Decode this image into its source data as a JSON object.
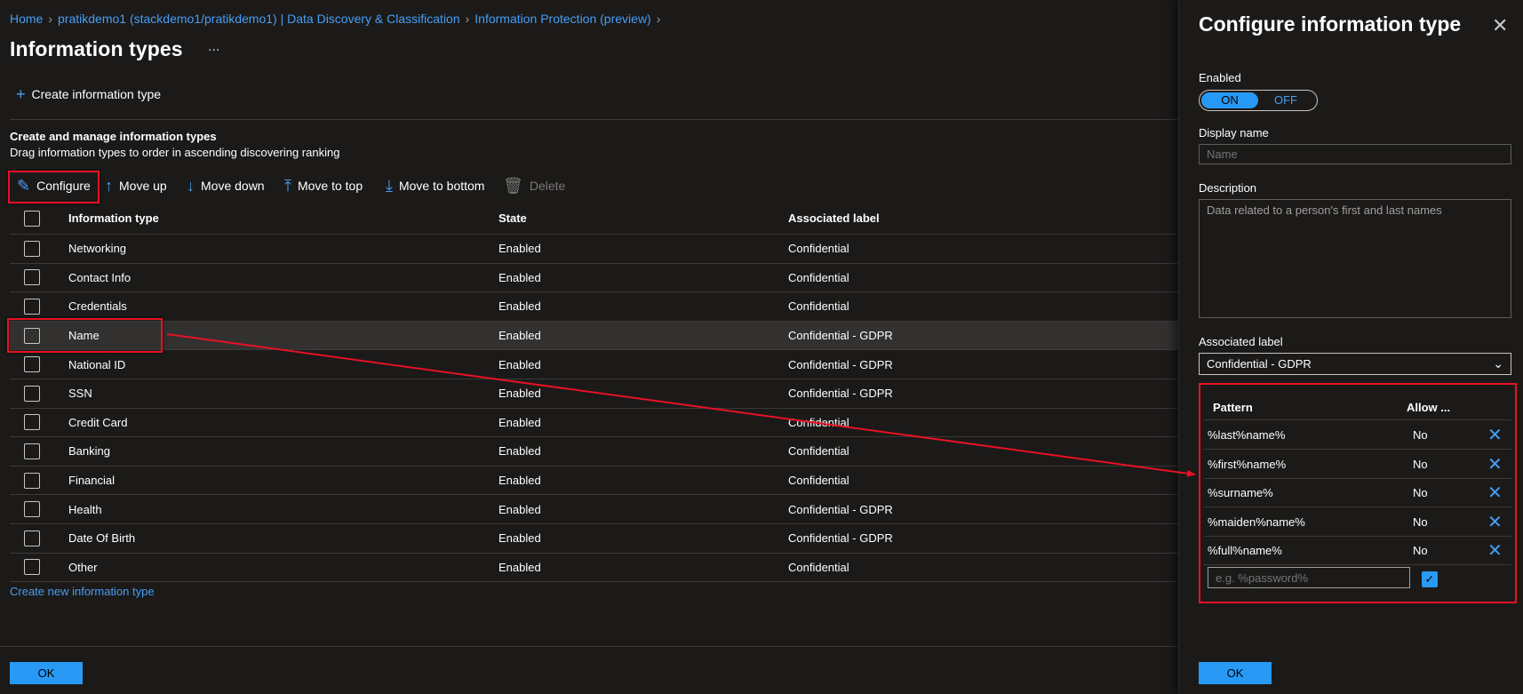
{
  "breadcrumb": [
    {
      "label": "Home"
    },
    {
      "label": "pratikdemo1 (stackdemo1/pratikdemo1) | Data Discovery & Classification"
    },
    {
      "label": "Information Protection (preview)"
    }
  ],
  "page": {
    "title": "Information types",
    "more": "..."
  },
  "top_command": {
    "label": "Create information type"
  },
  "section": {
    "title": "Create and manage information types",
    "subtitle": "Drag information types to order in ascending discovering ranking"
  },
  "toolbar": {
    "configure": "Configure",
    "move_up": "Move up",
    "move_down": "Move down",
    "move_top": "Move to top",
    "move_bottom": "Move to bottom",
    "delete": "Delete"
  },
  "table": {
    "columns": [
      "Information type",
      "State",
      "Associated label"
    ],
    "rows": [
      {
        "name": "Networking",
        "state": "Enabled",
        "label": "Confidential"
      },
      {
        "name": "Contact Info",
        "state": "Enabled",
        "label": "Confidential"
      },
      {
        "name": "Credentials",
        "state": "Enabled",
        "label": "Confidential"
      },
      {
        "name": "Name",
        "state": "Enabled",
        "label": "Confidential - GDPR",
        "selected": true
      },
      {
        "name": "National ID",
        "state": "Enabled",
        "label": "Confidential - GDPR"
      },
      {
        "name": "SSN",
        "state": "Enabled",
        "label": "Confidential - GDPR"
      },
      {
        "name": "Credit Card",
        "state": "Enabled",
        "label": "Confidential"
      },
      {
        "name": "Banking",
        "state": "Enabled",
        "label": "Confidential"
      },
      {
        "name": "Financial",
        "state": "Enabled",
        "label": "Confidential"
      },
      {
        "name": "Health",
        "state": "Enabled",
        "label": "Confidential - GDPR"
      },
      {
        "name": "Date Of Birth",
        "state": "Enabled",
        "label": "Confidential - GDPR"
      },
      {
        "name": "Other",
        "state": "Enabled",
        "label": "Confidential"
      }
    ]
  },
  "create_link": "Create new information type",
  "ok_label": "OK",
  "panel": {
    "title": "Configure information type",
    "enabled_label": "Enabled",
    "toggle_on": "ON",
    "toggle_off": "OFF",
    "display_name_label": "Display name",
    "display_name_placeholder": "Name",
    "description_label": "Description",
    "description_value": "Data related to a person's first and last names",
    "associated_label_label": "Associated label",
    "associated_label_value": "Confidential - GDPR",
    "pattern_col": "Pattern",
    "allow_col": "Allow ...",
    "patterns": [
      {
        "pattern": "%last%name%",
        "allow": "No"
      },
      {
        "pattern": "%first%name%",
        "allow": "No"
      },
      {
        "pattern": "%surname%",
        "allow": "No"
      },
      {
        "pattern": "%maiden%name%",
        "allow": "No"
      },
      {
        "pattern": "%full%name%",
        "allow": "No"
      }
    ],
    "new_pattern_placeholder": "e.g. %password%",
    "ok_label": "OK"
  },
  "colors": {
    "accent": "#2899f5",
    "link": "#479ef5",
    "highlight": "#e81123",
    "background": "#1b1a19"
  }
}
